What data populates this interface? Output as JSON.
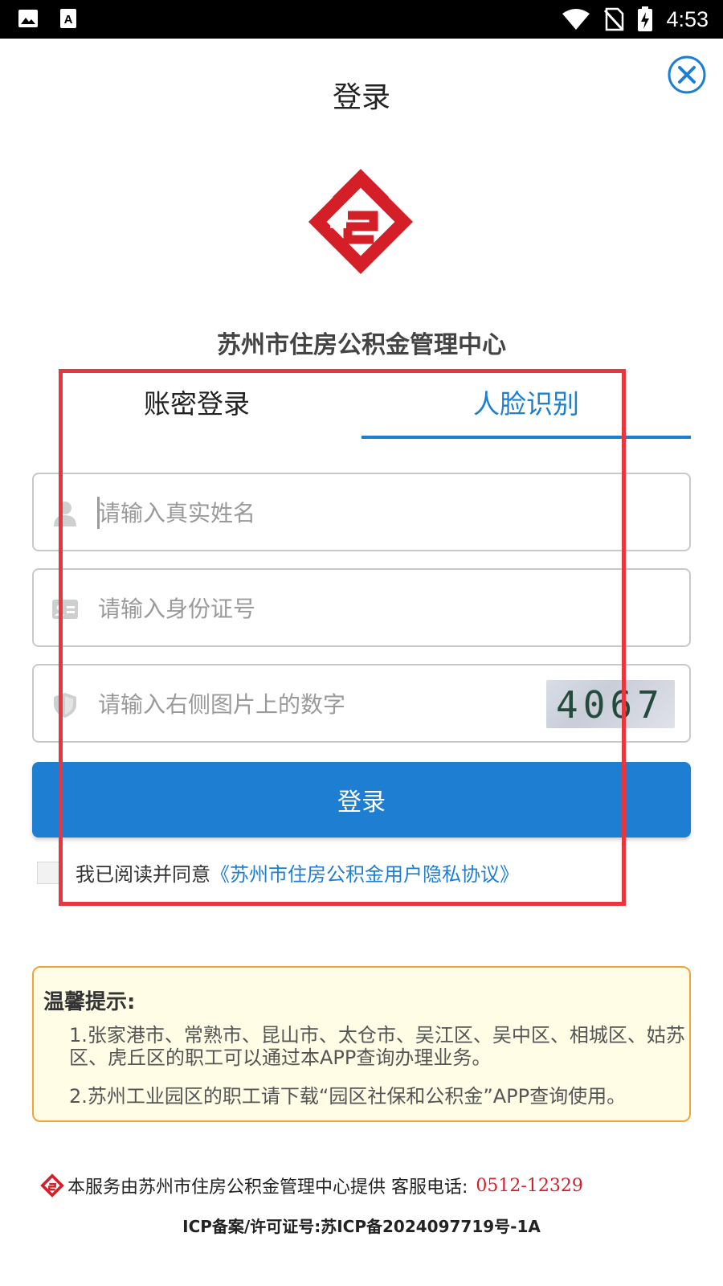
{
  "status_bar": {
    "time": "4:53",
    "left_icons": [
      "image-icon",
      "text-icon"
    ],
    "right_icons": [
      "wifi-icon",
      "no-sim-icon",
      "battery-charging-icon"
    ]
  },
  "header": {
    "title": "登录",
    "close_icon": "close-circle-icon"
  },
  "org_name": "苏州市住房公积金管理中心",
  "tabs": [
    {
      "label": "账密登录",
      "active": false
    },
    {
      "label": "人脸识别",
      "active": true
    }
  ],
  "form": {
    "name_placeholder": "请输入真实姓名",
    "id_placeholder": "请输入身份证号",
    "captcha_placeholder": "请输入右侧图片上的数字",
    "captcha_code": "4067",
    "login_label": "登录"
  },
  "agreement": {
    "text": "我已阅读并同意",
    "link": "《苏州市住房公积金用户隐私协议》"
  },
  "tips": {
    "title": "温馨提示:",
    "items": [
      "1.张家港市、常熟市、昆山市、太仓市、吴江区、吴中区、相城区、姑苏区、虎丘区的职工可以通过本APP查询办理业务。",
      "2.苏州工业园区的职工请下载“园区社保和公积金”APP查询使用。"
    ]
  },
  "footer": {
    "service_text": "本服务由苏州市住房公积金管理中心提供 客服电话:",
    "phone": "0512-12329",
    "icp": "ICP备案/许可证号:苏ICP备2024097719号-1A"
  },
  "colors": {
    "accent": "#1e7fd2",
    "brand_red": "#d41f28",
    "highlight_box": "#e8363e",
    "tips_border": "#f2a43a",
    "tips_bg": "#fffde6"
  }
}
